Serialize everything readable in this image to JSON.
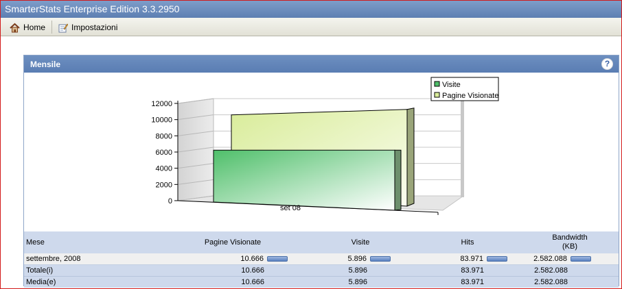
{
  "window": {
    "title": "SmarterStats Enterprise Edition 3.3.2950"
  },
  "toolbar": {
    "home_label": "Home",
    "settings_label": "Impostazioni"
  },
  "panel": {
    "title": "Mensile",
    "help_glyph": "?"
  },
  "chart_data": {
    "type": "bar",
    "categories": [
      "set 08"
    ],
    "series": [
      {
        "name": "Visite",
        "values": [
          5896
        ],
        "color": "#4fbf6a"
      },
      {
        "name": "Pagine Visionate",
        "values": [
          10666
        ],
        "color": "#d9ec9a"
      }
    ],
    "ylim": [
      0,
      12000
    ],
    "yticks": [
      "12000",
      "10000",
      "8000",
      "6000",
      "4000",
      "2000",
      "0"
    ],
    "legend_position": "top-right",
    "three_d": true
  },
  "table": {
    "headers": [
      "Mese",
      "Pagine Visionate",
      "Visite",
      "Hits",
      "Bandwidth (KB)"
    ],
    "rows": [
      {
        "label": "settembre, 2008",
        "pages": "10.666",
        "visits": "5.896",
        "hits": "83.971",
        "bandwidth": "2.582.088"
      },
      {
        "label": "Totale(i)",
        "pages": "10.666",
        "visits": "5.896",
        "hits": "83.971",
        "bandwidth": "2.582.088"
      },
      {
        "label": "Media(e)",
        "pages": "10.666",
        "visits": "5.896",
        "hits": "83.971",
        "bandwidth": "2.582.088"
      }
    ]
  }
}
